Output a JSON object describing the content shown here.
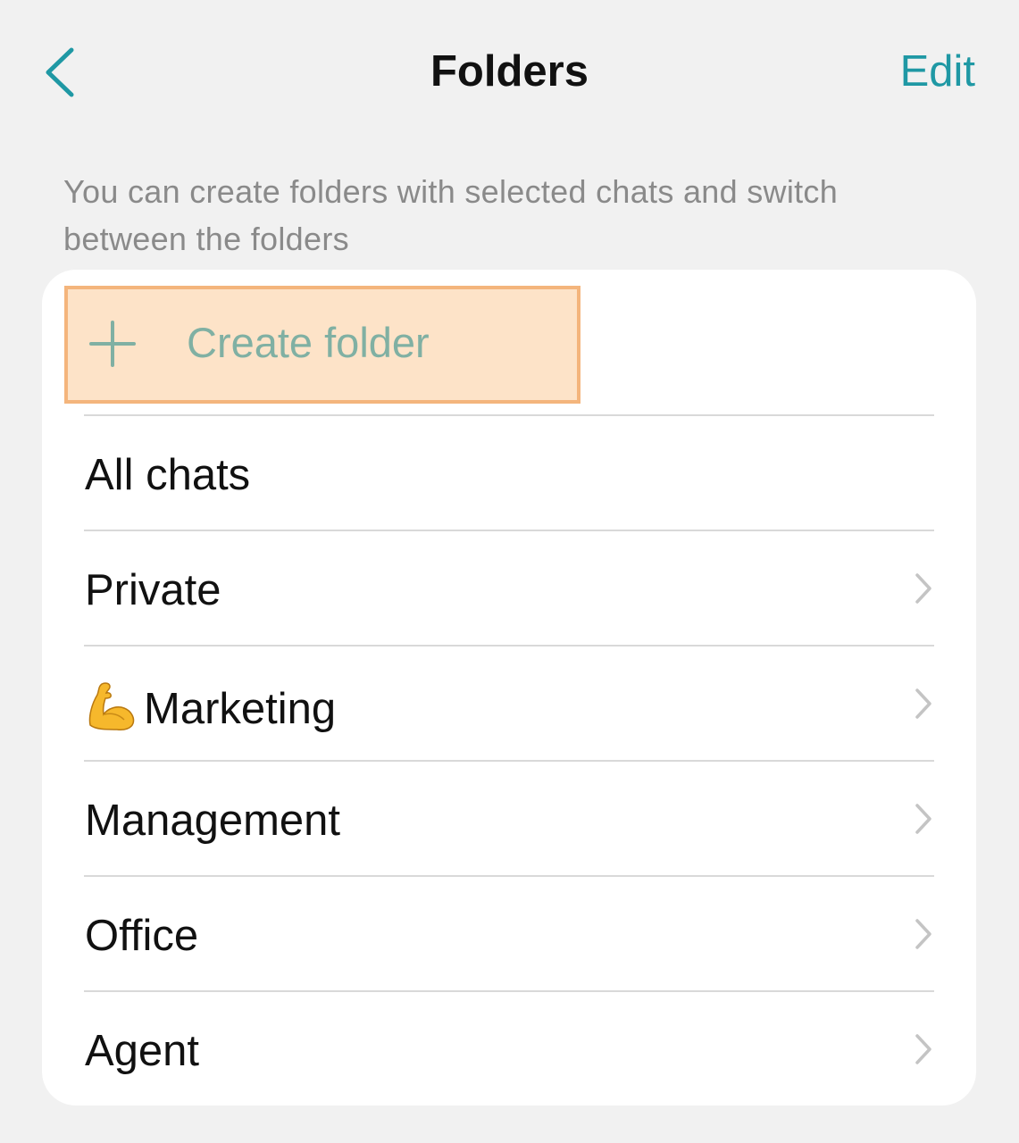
{
  "nav": {
    "back_icon": "chevron-left-icon",
    "title": "Folders",
    "edit_label": "Edit"
  },
  "description": "You can create folders with selected chats and switch between the folders",
  "create_folder": {
    "icon": "plus-icon",
    "label": "Create folder",
    "highlighted": true
  },
  "folders": [
    {
      "name": "all-chats",
      "label": "All chats",
      "has_chevron": false
    },
    {
      "name": "private",
      "label": "Private",
      "has_chevron": true
    },
    {
      "name": "marketing",
      "emoji": "flexed-biceps-icon",
      "label": "Marketing",
      "has_chevron": true
    },
    {
      "name": "management",
      "label": "Management",
      "has_chevron": true
    },
    {
      "name": "office",
      "label": "Office",
      "has_chevron": true
    },
    {
      "name": "agent",
      "label": "Agent",
      "has_chevron": true
    }
  ],
  "colors": {
    "accent": "#1f98a4",
    "background": "#f1f1f1",
    "card": "#ffffff",
    "highlight_fill": "#fde3c8",
    "highlight_border": "#f4b57c",
    "create_text": "#80b0a3",
    "secondary_text": "#8a8a8a",
    "chevron": "#c4c4c4"
  }
}
